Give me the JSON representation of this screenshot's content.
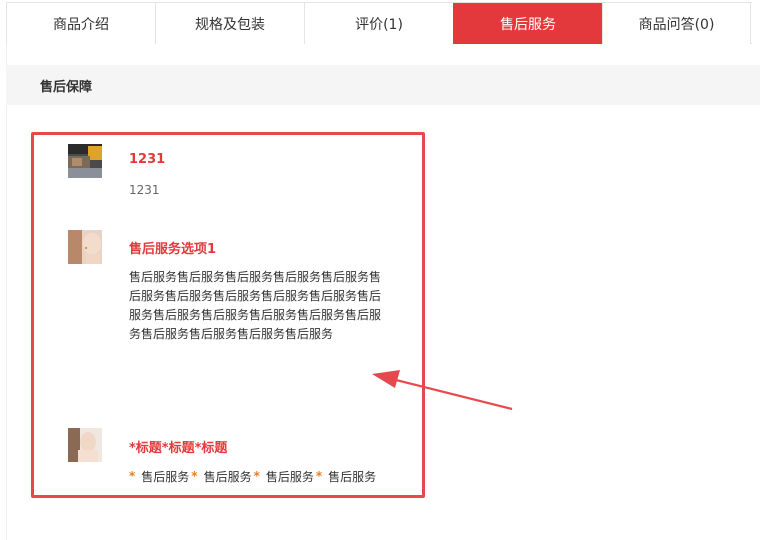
{
  "tabs": [
    {
      "label": "商品介绍",
      "active": false
    },
    {
      "label": "规格及包装",
      "active": false
    },
    {
      "label": "评价(1)",
      "active": false
    },
    {
      "label": "售后服务",
      "active": true
    },
    {
      "label": "商品问答(0)",
      "active": false
    }
  ],
  "section": {
    "title": "售后保障"
  },
  "items": [
    {
      "title": "1231",
      "desc": "1231",
      "thumb_icon": "food-photo-thumbnail"
    },
    {
      "title": "售后服务选项1",
      "body": "售后服务售后服务售后服务售后服务售后服务售后服务售后服务售后服务售后服务售后服务售后服务售后服务售后服务售后服务售后服务售后服务售后服务售后服务售后服务售后服务",
      "thumb_icon": "portrait-photo-thumbnail"
    },
    {
      "title": "*标题*标题*标题",
      "stars": [
        "售后服务",
        "售后服务",
        "售后服务",
        "售后服务"
      ],
      "star_symbol": "*",
      "thumb_icon": "portrait-photo-thumbnail"
    }
  ],
  "colors": {
    "accent": "#e4393c",
    "highlight": "#e5484d",
    "star": "#e67e22"
  }
}
